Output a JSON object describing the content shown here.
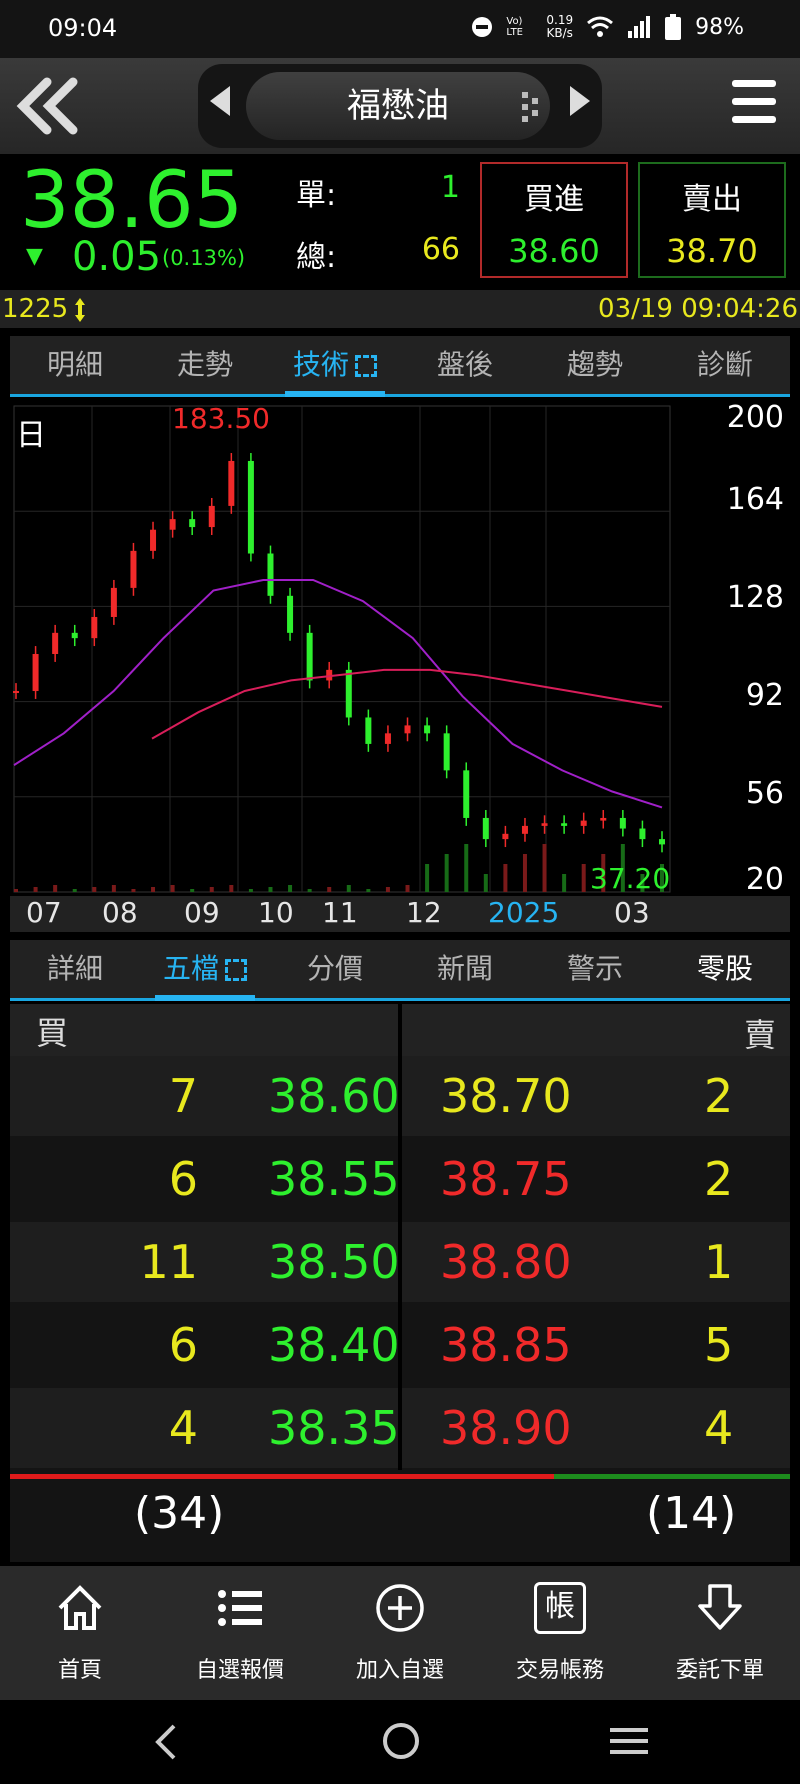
{
  "status": {
    "time": "09:04",
    "net_top": "0.19",
    "net_bottom": "KB/s",
    "volte": "Vo) LTE",
    "battery": "98%"
  },
  "header": {
    "stock_name": "福懋油"
  },
  "quote": {
    "price": "38.65",
    "change_arrow": "▼",
    "change": "0.05",
    "change_pct": "(0.13%)",
    "single_label": "單:",
    "single_value": "1",
    "total_label": "總:",
    "total_value": "66",
    "buy_label": "買進",
    "buy_price": "38.60",
    "sell_label": "賣出",
    "sell_price": "38.70",
    "stock_code": "1225",
    "datetime": "03/19 09:04:26"
  },
  "top_tabs": [
    "明細",
    "走勢",
    "技術",
    "盤後",
    "趨勢",
    "診斷"
  ],
  "chart_data": {
    "type": "line",
    "period_label": "日",
    "high_label": "183.50",
    "low_label": "37.20",
    "y_ticks": [
      "200",
      "164",
      "128",
      "92",
      "56",
      "20"
    ],
    "x_ticks": [
      "07",
      "08",
      "09",
      "10",
      "11",
      "12",
      "2025",
      "03"
    ],
    "ylim": [
      20,
      200
    ],
    "series": [
      {
        "values": [
          96,
          110,
          118,
          116,
          124,
          135,
          149,
          157,
          161,
          158,
          166,
          183,
          148,
          132,
          118,
          100,
          104,
          86,
          76,
          80,
          83,
          80,
          66,
          48,
          40,
          42,
          45,
          46,
          45,
          47,
          48,
          44,
          40,
          38
        ]
      },
      {
        "values": [
          68,
          80,
          96,
          116,
          134,
          138,
          138,
          130,
          116,
          94,
          76,
          66,
          58,
          52
        ]
      },
      {
        "values": [
          78,
          88,
          96,
          100,
          102,
          104,
          104,
          102,
          99,
          96,
          93,
          90
        ]
      }
    ],
    "colors": {
      "up": "#f02a2a",
      "down": "#2ef02e",
      "ma_short": "#a020c8",
      "ma_long": "#d81e5a"
    }
  },
  "mid_tabs": [
    "詳細",
    "五檔",
    "分價",
    "新聞",
    "警示",
    "零股"
  ],
  "book": {
    "buy_header": "買",
    "sell_header": "賣",
    "rows": [
      {
        "bid_qty": "7",
        "bid": "38.60",
        "ask": "38.70",
        "ask_qty": "2"
      },
      {
        "bid_qty": "6",
        "bid": "38.55",
        "ask": "38.75",
        "ask_qty": "2"
      },
      {
        "bid_qty": "11",
        "bid": "38.50",
        "ask": "38.80",
        "ask_qty": "1"
      },
      {
        "bid_qty": "6",
        "bid": "38.40",
        "ask": "38.85",
        "ask_qty": "5"
      },
      {
        "bid_qty": "4",
        "bid": "38.35",
        "ask": "38.90",
        "ask_qty": "4"
      }
    ],
    "bid_total": "(34)",
    "ask_total": "(14)"
  },
  "bottom_nav": [
    "首頁",
    "自選報價",
    "加入自選",
    "交易帳務",
    "委託下單"
  ],
  "nav_icons": {
    "trade_glyph": "帳"
  }
}
